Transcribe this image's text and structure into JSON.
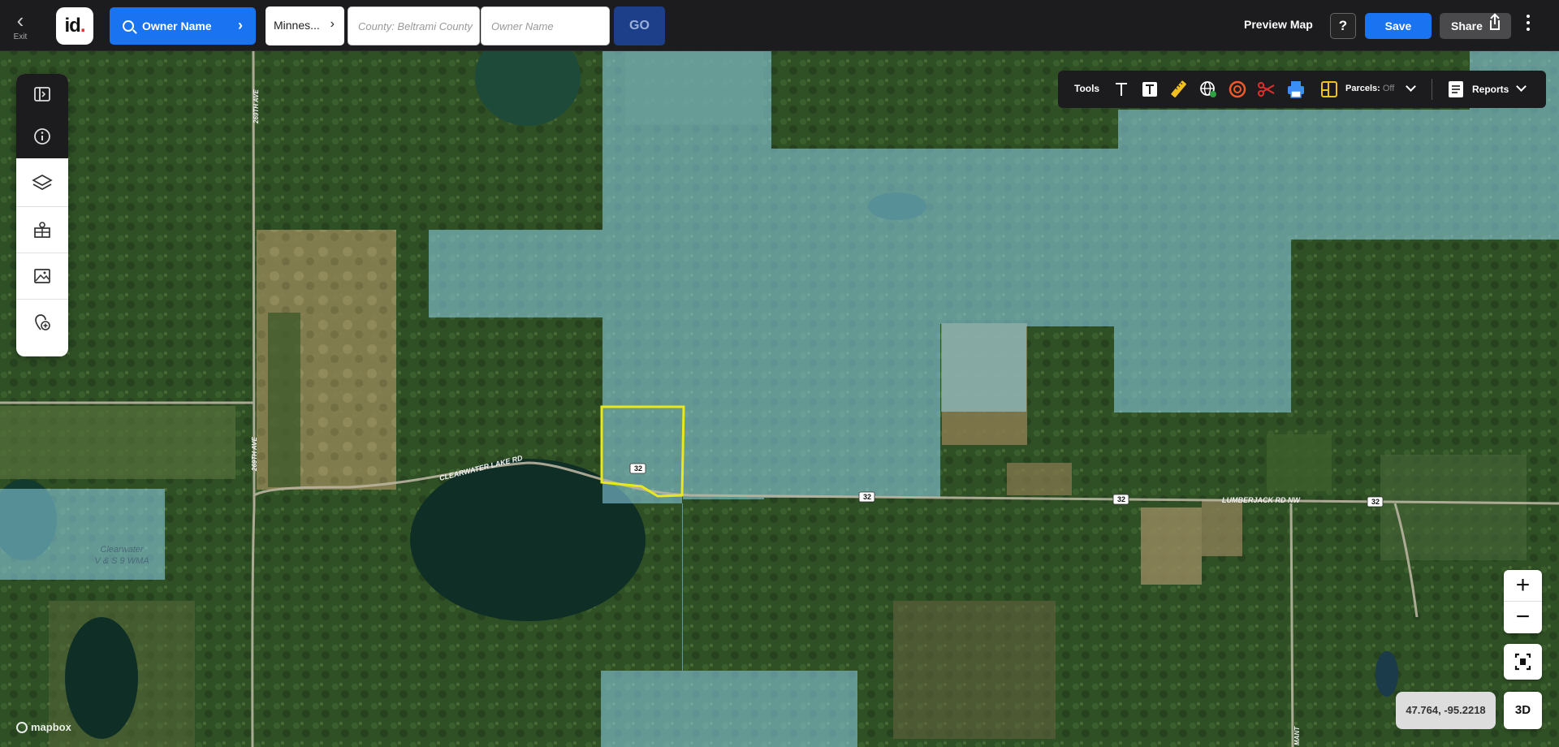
{
  "topbar": {
    "exit_label": "Exit",
    "logo_text": "id",
    "search_label": "Owner Name",
    "state_value": "Minnes...",
    "county_placeholder": "County: Beltrami County",
    "owner_placeholder": "Owner Name",
    "go_label": "GO",
    "preview_label": "Preview Map",
    "help_label": "?",
    "save_label": "Save",
    "share_label": "Share"
  },
  "tools": {
    "label": "Tools",
    "parcels_label": "Parcels:",
    "parcels_state": "Off",
    "reports_label": "Reports"
  },
  "map": {
    "road_labels": {
      "clearwater_lake_rd": "CLEARWATER LAKE RD",
      "lumberjack_rd": "LUMBERJACK RD NW",
      "ave_269_top": "269TH AVE",
      "ave_269_bottom": "269TH AVE",
      "mani": "MANT"
    },
    "route_shields": [
      "32",
      "32",
      "32",
      "32"
    ],
    "wma_label_line1": "Clearwater",
    "wma_label_line2": "V & S 9 WMA",
    "attribution": "mapbox"
  },
  "controls": {
    "zoom_in": "+",
    "zoom_out": "−",
    "coords": "47.764, -95.2218",
    "btn_3d": "3D"
  },
  "colors": {
    "brand_blue": "#1a73f0",
    "go_navy": "#1d3f8a",
    "overlay_blue": "#8fd6ef",
    "parcel_yellow": "#e8e81a"
  }
}
